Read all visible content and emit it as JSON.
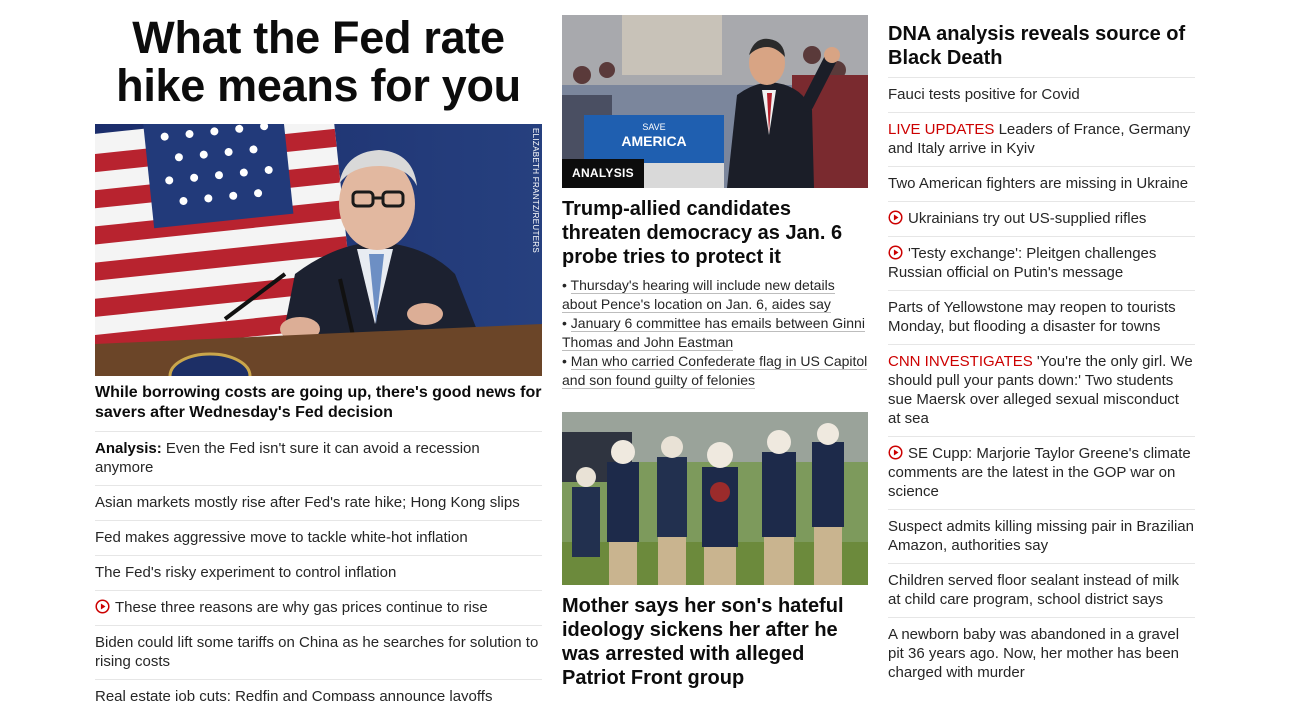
{
  "col1": {
    "headline": "What the Fed rate hike means for you",
    "photo_credit": "ELIZABETH FRANTZ/REUTERS",
    "caption": "While borrowing costs are going up, there's good news for savers after Wednesday's Fed decision",
    "items": [
      {
        "prefix": "Analysis:",
        "text": "Even the Fed isn't sure it can avoid a recession anymore"
      },
      {
        "text": "Asian markets mostly rise after Fed's rate hike; Hong Kong slips"
      },
      {
        "text": "Fed makes aggressive move to tackle white-hot inflation"
      },
      {
        "text": "The Fed's risky experiment to control inflation"
      },
      {
        "video": true,
        "text": "These three reasons are why gas prices continue to rise"
      },
      {
        "text": "Biden could lift some tariffs on China as he searches for solution to rising costs"
      },
      {
        "text": "Real estate job cuts: Redfin and Compass announce layoffs"
      }
    ]
  },
  "col2": {
    "story1": {
      "badge": "ANALYSIS",
      "sign_text_1": "SAVE",
      "sign_text_2": "AMERICA",
      "headline": "Trump-allied candidates threaten democracy as Jan. 6 probe tries to protect it",
      "bullets": [
        "Thursday's hearing will include new details about Pence's location on Jan. 6, aides say",
        "January 6 committee has emails between Ginni Thomas and John Eastman",
        "Man who carried Confederate flag in US Capitol and son found guilty of felonies"
      ]
    },
    "story2": {
      "headline": "Mother says her son's hateful ideology sickens her after he was arrested with alleged Patriot Front group"
    }
  },
  "col3": {
    "lead": "DNA analysis reveals source of Black Death",
    "items": [
      {
        "text": "Fauci tests positive for Covid"
      },
      {
        "label": "LIVE UPDATES",
        "text": " Leaders of France, Germany and Italy arrive in Kyiv"
      },
      {
        "text": "Two American fighters are missing in Ukraine"
      },
      {
        "video": true,
        "text": "Ukrainians try out US-supplied rifles"
      },
      {
        "video": true,
        "text": "'Testy exchange': Pleitgen challenges Russian official on Putin's message"
      },
      {
        "text": "Parts of Yellowstone may reopen to tourists Monday, but flooding a disaster for towns"
      },
      {
        "label": "CNN INVESTIGATES",
        "text": " 'You're the only girl. We should pull your pants down:' Two students sue Maersk over alleged sexual misconduct at sea"
      },
      {
        "video": true,
        "text": "SE Cupp: Marjorie Taylor Greene's climate comments are the latest in the GOP war on science"
      },
      {
        "text": "Suspect admits killing missing pair in Brazilian Amazon, authorities say"
      },
      {
        "text": "Children served floor sealant instead of milk at child care program, school district says"
      },
      {
        "text": "A newborn baby was abandoned in a gravel pit 36 years ago. Now, her mother has been charged with murder"
      }
    ]
  },
  "colors": {
    "live_label": "#cc0000",
    "text": "#262626",
    "divider": "#e6e6e6"
  }
}
